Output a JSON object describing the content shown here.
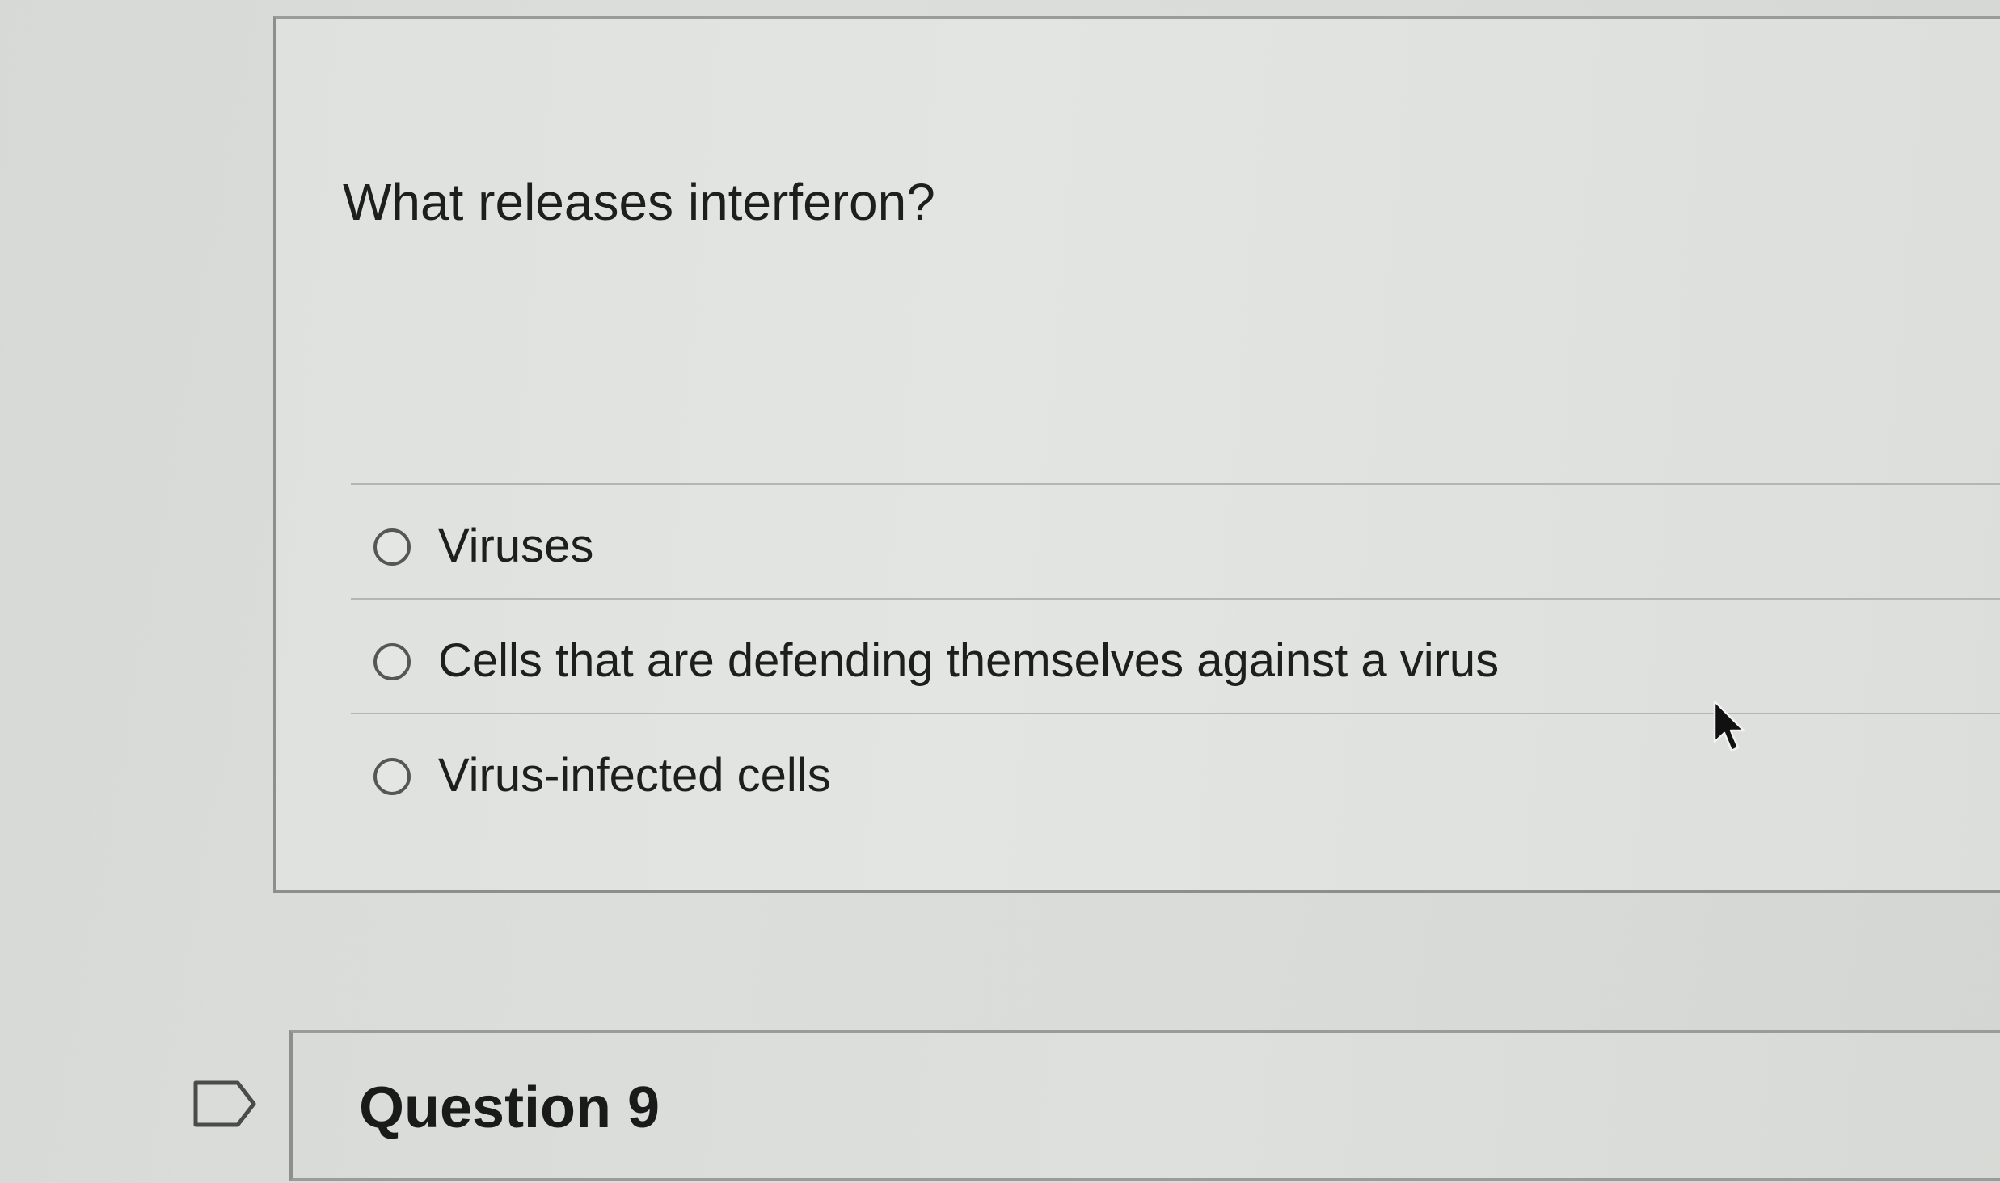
{
  "question": {
    "text": "What releases interferon?",
    "answers": [
      {
        "label": "Viruses",
        "selected": false
      },
      {
        "label": "Cells that are defending themselves against a virus",
        "selected": false
      },
      {
        "label": "Virus-infected cells",
        "selected": false
      }
    ]
  },
  "next_question": {
    "title": "Question 9",
    "flag_icon": "flag-outline-icon"
  },
  "cursor": {
    "icon": "arrow-pointer-icon"
  },
  "colors": {
    "background": "#dcdedc",
    "text": "#1e1e1e",
    "border": "#8d8f8d",
    "radio_border": "#555755"
  }
}
